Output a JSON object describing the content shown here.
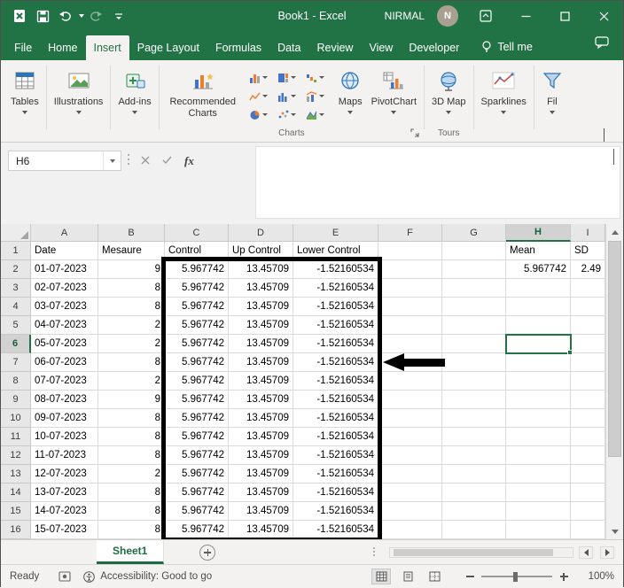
{
  "window": {
    "title": "Book1 - Excel",
    "user": "NIRMAL",
    "avatar_initial": "N"
  },
  "menu": {
    "tabs": [
      {
        "label": "File"
      },
      {
        "label": "Home"
      },
      {
        "label": "Insert",
        "active": true
      },
      {
        "label": "Page Layout"
      },
      {
        "label": "Formulas"
      },
      {
        "label": "Data"
      },
      {
        "label": "Review"
      },
      {
        "label": "View"
      },
      {
        "label": "Developer"
      }
    ],
    "tell_me": "Tell me"
  },
  "ribbon": {
    "tables": "Tables",
    "illustrations": "Illustrations",
    "addins": "Add-ins",
    "recommended_line1": "Recommended",
    "recommended_line2": "Charts",
    "charts_group_label": "Charts",
    "maps": "Maps",
    "pivotchart": "PivotChart",
    "map3d_line1": "3D",
    "map3d_line2": "Map",
    "tours_group_label": "Tours",
    "sparklines": "Sparklines",
    "filters_partial": "Fil"
  },
  "formula_bar": {
    "name_box": "H6",
    "fx_label": "fx"
  },
  "grid": {
    "columns": [
      "A",
      "B",
      "C",
      "D",
      "E",
      "F",
      "G",
      "H",
      "I"
    ],
    "selected_column": "H",
    "selected_row_number": 6,
    "selected_cell": "H6",
    "header_row": {
      "A": "Date",
      "B": "Mesaure",
      "C": "Control",
      "D": "Up Control",
      "E": "Lower Control",
      "F": "",
      "G": "",
      "H": "Mean",
      "I": "SD"
    },
    "rows": [
      {
        "n": 2,
        "date": "01-07-2023",
        "measure": "9",
        "control": "5.967742",
        "up_control": "13.45709",
        "lower_control": "-1.52160534",
        "mean": "5.967742",
        "sd": "2.49"
      },
      {
        "n": 3,
        "date": "02-07-2023",
        "measure": "8",
        "control": "5.967742",
        "up_control": "13.45709",
        "lower_control": "-1.52160534"
      },
      {
        "n": 4,
        "date": "03-07-2023",
        "measure": "8",
        "control": "5.967742",
        "up_control": "13.45709",
        "lower_control": "-1.52160534"
      },
      {
        "n": 5,
        "date": "04-07-2023",
        "measure": "2",
        "control": "5.967742",
        "up_control": "13.45709",
        "lower_control": "-1.52160534"
      },
      {
        "n": 6,
        "date": "05-07-2023",
        "measure": "2",
        "control": "5.967742",
        "up_control": "13.45709",
        "lower_control": "-1.52160534"
      },
      {
        "n": 7,
        "date": "06-07-2023",
        "measure": "8",
        "control": "5.967742",
        "up_control": "13.45709",
        "lower_control": "-1.52160534"
      },
      {
        "n": 8,
        "date": "07-07-2023",
        "measure": "2",
        "control": "5.967742",
        "up_control": "13.45709",
        "lower_control": "-1.52160534"
      },
      {
        "n": 9,
        "date": "08-07-2023",
        "measure": "9",
        "control": "5.967742",
        "up_control": "13.45709",
        "lower_control": "-1.52160534"
      },
      {
        "n": 10,
        "date": "09-07-2023",
        "measure": "8",
        "control": "5.967742",
        "up_control": "13.45709",
        "lower_control": "-1.52160534"
      },
      {
        "n": 11,
        "date": "10-07-2023",
        "measure": "8",
        "control": "5.967742",
        "up_control": "13.45709",
        "lower_control": "-1.52160534"
      },
      {
        "n": 12,
        "date": "11-07-2023",
        "measure": "8",
        "control": "5.967742",
        "up_control": "13.45709",
        "lower_control": "-1.52160534"
      },
      {
        "n": 13,
        "date": "12-07-2023",
        "measure": "2",
        "control": "5.967742",
        "up_control": "13.45709",
        "lower_control": "-1.52160534"
      },
      {
        "n": 14,
        "date": "13-07-2023",
        "measure": "8",
        "control": "5.967742",
        "up_control": "13.45709",
        "lower_control": "-1.52160534"
      },
      {
        "n": 15,
        "date": "14-07-2023",
        "measure": "8",
        "control": "5.967742",
        "up_control": "13.45709",
        "lower_control": "-1.52160534"
      },
      {
        "n": 16,
        "date": "15-07-2023",
        "measure": "8",
        "control": "5.967742",
        "up_control": "13.45709",
        "lower_control": "-1.52160534"
      }
    ]
  },
  "sheets": {
    "active_tab": "Sheet1"
  },
  "status_bar": {
    "mode": "Ready",
    "accessibility": "Accessibility: Good to go",
    "zoom_level": "100%"
  },
  "colors": {
    "excel_green": "#217346",
    "annotation": "#000000"
  }
}
